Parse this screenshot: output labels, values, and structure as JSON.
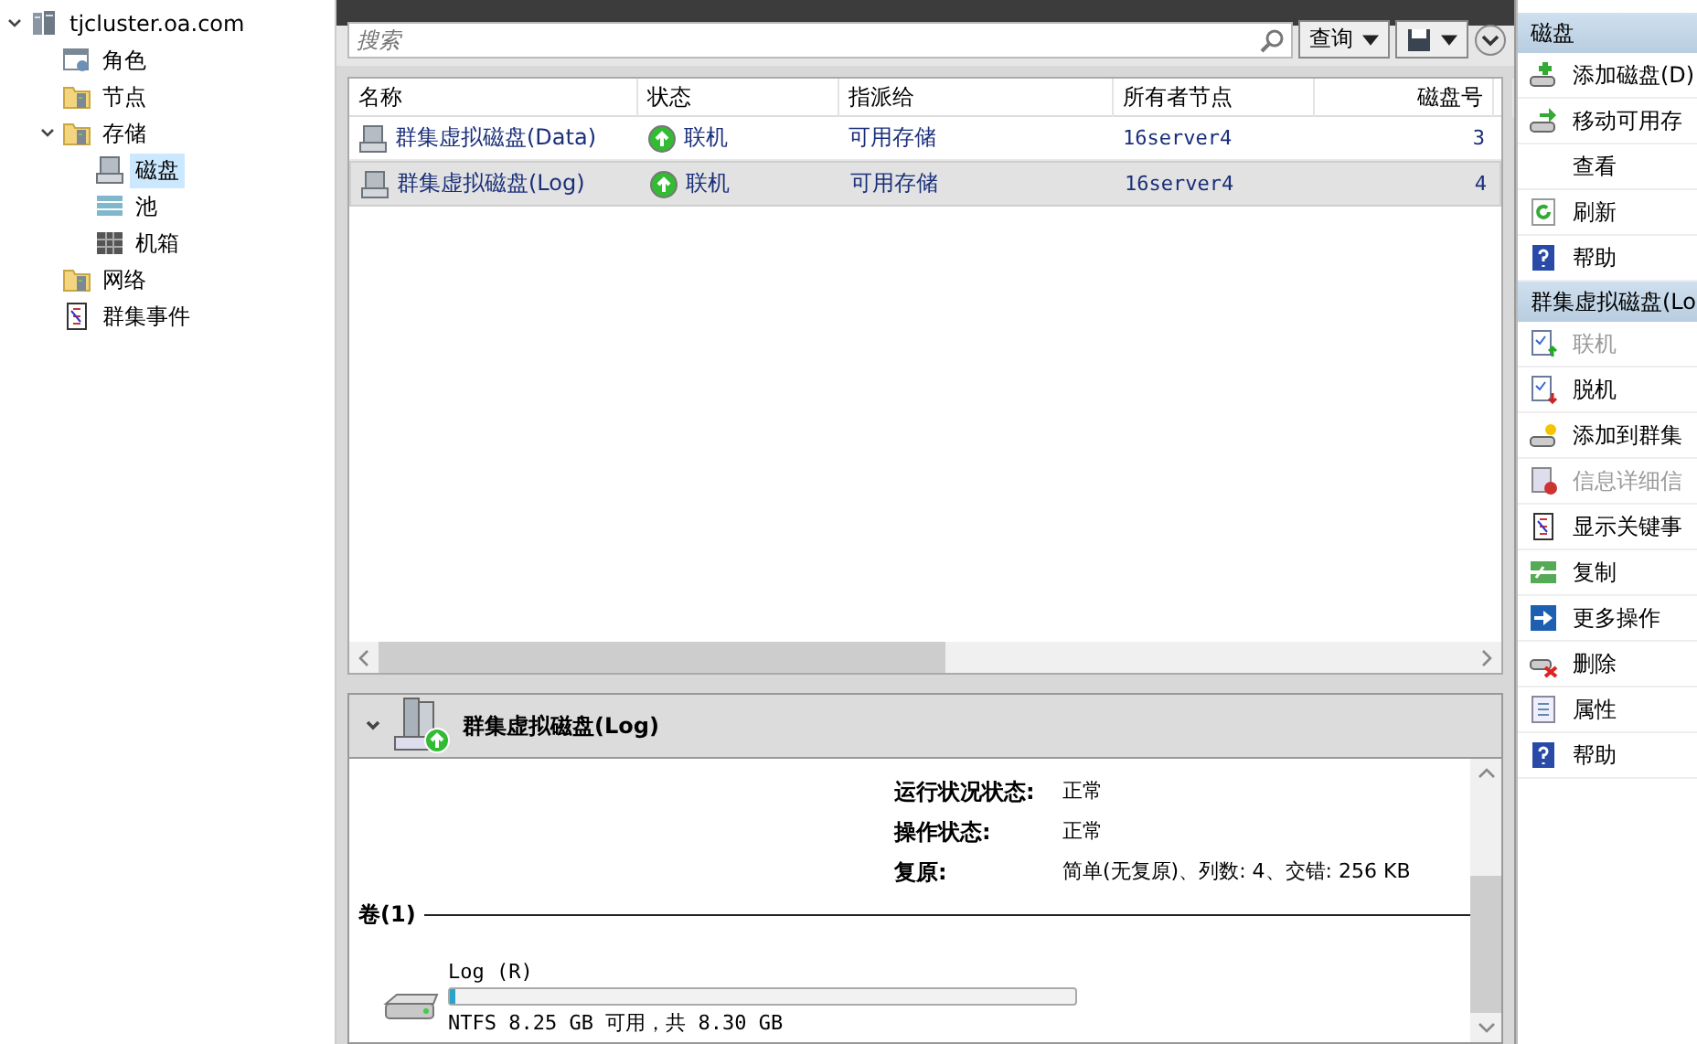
{
  "tree": [
    {
      "label": "tjcluster.oa.com",
      "expanded": true,
      "selected": false,
      "children": [
        {
          "label": "角色",
          "selected": false
        },
        {
          "label": "节点",
          "selected": false
        },
        {
          "label": "存储",
          "expanded": true,
          "selected": false,
          "children": [
            {
              "label": "磁盘",
              "selected": true
            },
            {
              "label": "池",
              "selected": false
            },
            {
              "label": "机箱",
              "selected": false
            }
          ]
        },
        {
          "label": "网络",
          "selected": false
        },
        {
          "label": "群集事件",
          "selected": false
        }
      ]
    }
  ],
  "search": {
    "placeholder": "搜索",
    "query_button": "查询"
  },
  "table": {
    "columns": [
      "名称",
      "状态",
      "指派给",
      "所有者节点",
      "磁盘号"
    ],
    "rows": [
      {
        "name": "群集虚拟磁盘(Data)",
        "status": "联机",
        "assigned": "可用存储",
        "owner": "16server4",
        "disk_number": "3",
        "selected": false
      },
      {
        "name": "群集虚拟磁盘(Log)",
        "status": "联机",
        "assigned": "可用存储",
        "owner": "16server4",
        "disk_number": "4",
        "selected": true
      }
    ]
  },
  "details": {
    "title": "群集虚拟磁盘(Log)",
    "expanded": true,
    "properties": [
      {
        "label": "运行状况状态:",
        "value": "正常"
      },
      {
        "label": "操作状态:",
        "value": "正常"
      },
      {
        "label": "复原:",
        "value": "简单(无复原)、列数: 4、交错: 256 KB"
      }
    ],
    "volumes_heading": "卷(1)",
    "volume": {
      "name": "Log (R)",
      "level": 0.01,
      "summary": "NTFS 8.25 GB 可用，共 8.30 GB"
    }
  },
  "actions": [
    {
      "heading": "磁盘",
      "items": [
        {
          "label": "添加磁盘(D)",
          "disabled": false
        },
        {
          "label": "移动可用存",
          "disabled": false
        },
        {
          "label": "查看",
          "disabled": false
        },
        {
          "label": "刷新",
          "disabled": false
        },
        {
          "label": "帮助",
          "disabled": false
        }
      ]
    },
    {
      "heading": "群集虚拟磁盘(Lo",
      "items": [
        {
          "label": "联机",
          "disabled": true
        },
        {
          "label": "脱机",
          "disabled": false
        },
        {
          "label": "添加到群集",
          "disabled": false
        },
        {
          "label": "信息详细信",
          "disabled": true
        },
        {
          "label": "显示关键事",
          "disabled": false
        },
        {
          "label": "复制",
          "disabled": false
        },
        {
          "label": "更多操作",
          "disabled": false
        },
        {
          "label": "删除",
          "disabled": false
        },
        {
          "label": "属性",
          "disabled": false
        },
        {
          "label": "帮助",
          "disabled": false
        }
      ]
    }
  ]
}
